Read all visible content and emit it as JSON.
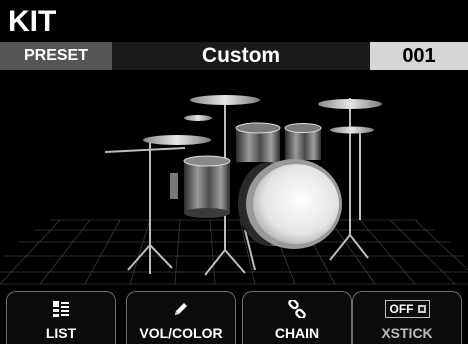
{
  "screen": {
    "title": "KIT"
  },
  "preset": {
    "label": "PRESET",
    "name": "Custom",
    "number": "001"
  },
  "stage": {
    "image": "drum-kit-illustration"
  },
  "buttons": [
    {
      "label": "LIST",
      "icon": "list-icon"
    },
    {
      "label": "VOL/COLOR",
      "icon": "pencil-icon"
    },
    {
      "label": "CHAIN",
      "icon": "chain-link-icon"
    },
    {
      "label": "XSTICK",
      "icon": "off-toggle-icon",
      "toggle_text": "OFF"
    }
  ]
}
